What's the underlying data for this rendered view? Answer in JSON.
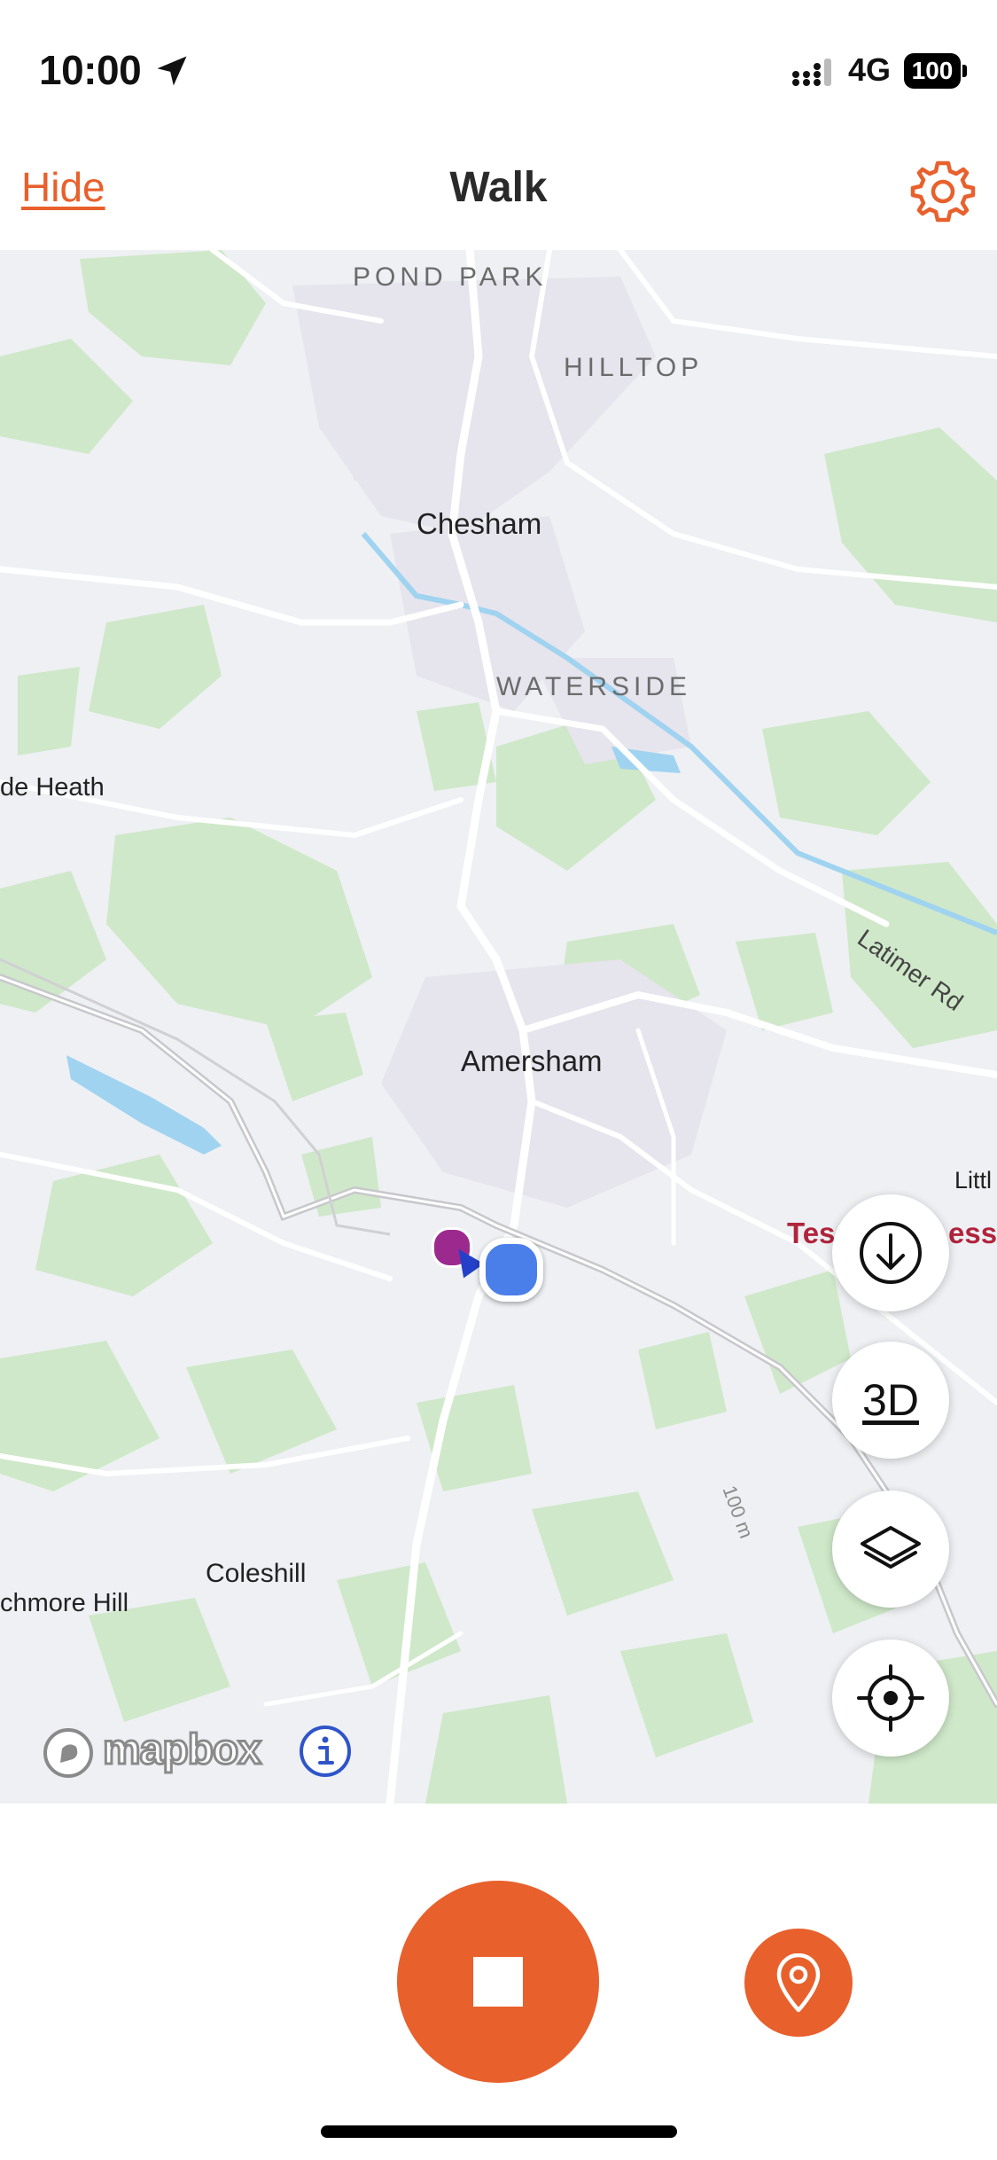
{
  "status_bar": {
    "time": "10:00",
    "network": "4G",
    "battery": "100",
    "icons": [
      "location-arrow-icon",
      "signal-icon",
      "battery-icon"
    ]
  },
  "nav": {
    "hide_label": "Hide",
    "title": "Walk",
    "settings_icon": "gear-icon"
  },
  "map": {
    "labels": {
      "pond_park": "POND PARK",
      "hilltop": "HILLTOP",
      "chesham": "Chesham",
      "waterside": "WATERSIDE",
      "de_heath": "de Heath",
      "latimer_rd": "Latimer Rd",
      "amersham": "Amersham",
      "little": "Littl",
      "tesco_left": "Tes",
      "tesco_right": "ess",
      "coleshill": "Coleshill",
      "chmore_hill": "chmore Hill",
      "contour_100": "100 m"
    },
    "controls": {
      "download_icon": "download-icon",
      "three_d_label": "3D",
      "layers_icon": "layers-icon",
      "locate_icon": "crosshair-icon"
    },
    "attribution": {
      "logo_text": "mapbox",
      "info_icon": "info-icon"
    }
  },
  "bottom": {
    "stop_icon": "stop-icon",
    "waypoint_icon": "map-pin-icon"
  },
  "colors": {
    "accent": "#e8602c",
    "user_location": "#4a7ee8",
    "map_background": "#eef0f3",
    "woodland": "#cfe8c9",
    "water": "#9fd3f0",
    "poi": "#b0243c"
  }
}
